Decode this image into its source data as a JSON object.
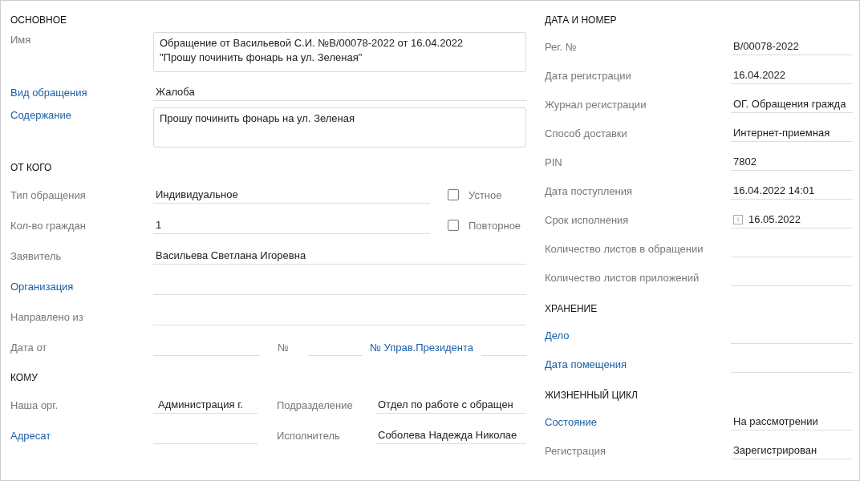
{
  "left_sections": [
    {
      "title": "ОСНОВНОЕ",
      "rows": [
        {
          "kind": "textarea",
          "label": "Имя",
          "link": false,
          "lines": [
            "Обращение от Васильевой С.И. №В/00078-2022 от 16.04.2022",
            "\"Прошу починить фонарь на ул. Зеленая\""
          ]
        },
        {
          "kind": "field",
          "label": "Вид обращения",
          "link": true,
          "value": "Жалоба"
        },
        {
          "kind": "textarea",
          "label": "Содержание",
          "link": true,
          "lines": [
            "Прошу починить фонарь на ул. Зеленая"
          ]
        }
      ]
    },
    {
      "title": "ОТ КОГО",
      "rows": [
        {
          "kind": "field_checkbox",
          "label": "Тип обращения",
          "link": false,
          "value": "Индивидуальное",
          "checkbox": {
            "label": "Устное",
            "checked": false
          }
        },
        {
          "kind": "field_checkbox",
          "label": "Кол-во граждан",
          "link": false,
          "value": "1",
          "checkbox": {
            "label": "Повторное",
            "checked": false
          }
        },
        {
          "kind": "field",
          "label": "Заявитель",
          "link": false,
          "value": "Васильева Светлана Игоревна"
        },
        {
          "kind": "field",
          "label": "Организация",
          "link": true
        },
        {
          "kind": "field",
          "label": "Направлено из",
          "link": false
        },
        {
          "kind": "multi",
          "label": "Дата от",
          "link": false,
          "items": [
            {
              "kind": "field"
            },
            {
              "kind": "label",
              "text": "№",
              "link": false
            },
            {
              "kind": "field"
            },
            {
              "kind": "label",
              "text": "№ Управ.Президента",
              "link": true
            },
            {
              "kind": "field"
            }
          ]
        }
      ]
    },
    {
      "title": "КОМУ",
      "rows": [
        {
          "kind": "pair",
          "label": "Наша орг.",
          "link": false,
          "value": "Администрация г.",
          "second": {
            "label": "Подразделение",
            "link": false,
            "value": "Отдел по работе с обращен"
          }
        },
        {
          "kind": "pair",
          "label": "Адресат",
          "link": true,
          "second": {
            "label": "Исполнитель",
            "link": false,
            "value": "Соболева Надежда Николае"
          }
        }
      ]
    }
  ],
  "right_sections": [
    {
      "title": "ДАТА И НОМЕР",
      "rows": [
        {
          "kind": "field",
          "label": "Рег. №",
          "link": false,
          "value": "В/00078-2022"
        },
        {
          "kind": "field",
          "label": "Дата регистрации",
          "link": false,
          "value": "16.04.2022"
        },
        {
          "kind": "field",
          "label": "Журнал регистрации",
          "link": false,
          "value": "ОГ. Обращения гражда"
        },
        {
          "kind": "field",
          "label": "Способ доставки",
          "link": false,
          "value": "Интернет-приемная"
        },
        {
          "kind": "field",
          "label": "PIN",
          "link": false,
          "value": "7802"
        },
        {
          "kind": "field",
          "label": "Дата поступления",
          "link": false,
          "value": "16.04.2022 14:01"
        },
        {
          "kind": "date",
          "label": "Срок исполнения",
          "link": false,
          "value": "16.05.2022"
        },
        {
          "kind": "field",
          "label": "Количество листов в обращении",
          "link": false
        },
        {
          "kind": "field",
          "label": "Количество листов приложений",
          "link": false
        }
      ]
    },
    {
      "title": "ХРАНЕНИЕ",
      "rows": [
        {
          "kind": "field",
          "label": "Дело",
          "link": true
        },
        {
          "kind": "field",
          "label": "Дата помещения",
          "link": true
        }
      ]
    },
    {
      "title": "ЖИЗНЕННЫЙ ЦИКЛ",
      "rows": [
        {
          "kind": "field",
          "label": "Состояние",
          "link": true,
          "value": "На рассмотрении"
        },
        {
          "kind": "field",
          "label": "Регистрация",
          "link": false,
          "value": "Зарегистрирован"
        }
      ]
    }
  ]
}
